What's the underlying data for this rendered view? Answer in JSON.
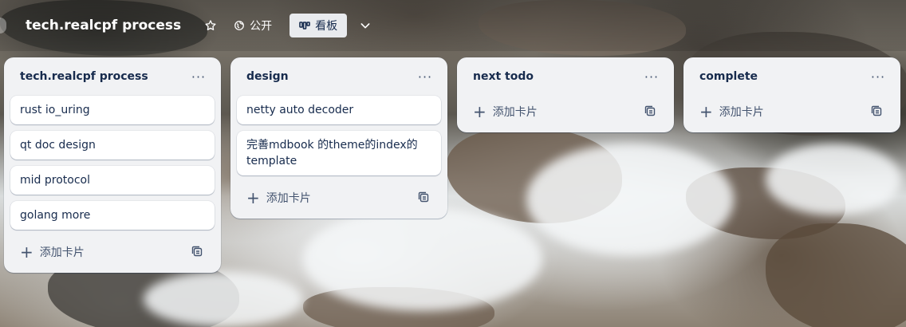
{
  "header": {
    "board_title": "tech.realcpf process",
    "star_icon": "star-icon",
    "visibility_label": "公开",
    "visibility_icon": "globe-icon",
    "view_label": "看板",
    "view_icon": "board-view-icon",
    "more_icon": "chevron-down-icon"
  },
  "lists": [
    {
      "title": "tech.realcpf process",
      "menu_label": "···",
      "cards": [
        "rust io_uring",
        "qt doc design",
        "mid protocol",
        "golang more"
      ],
      "add_card_label": "添加卡片"
    },
    {
      "title": "design",
      "menu_label": "···",
      "cards": [
        "netty auto decoder",
        "完善mdbook 的theme的index的template"
      ],
      "add_card_label": "添加卡片"
    },
    {
      "title": "next todo",
      "menu_label": "···",
      "cards": [],
      "add_card_label": "添加卡片"
    },
    {
      "title": "complete",
      "menu_label": "···",
      "cards": [],
      "add_card_label": "添加卡片"
    }
  ],
  "colors": {
    "list_bg": "#f1f2f4",
    "card_bg": "#ffffff",
    "text": "#172b4d",
    "subtle_text": "#44546f",
    "view_button_bg": "#e9ebee"
  }
}
